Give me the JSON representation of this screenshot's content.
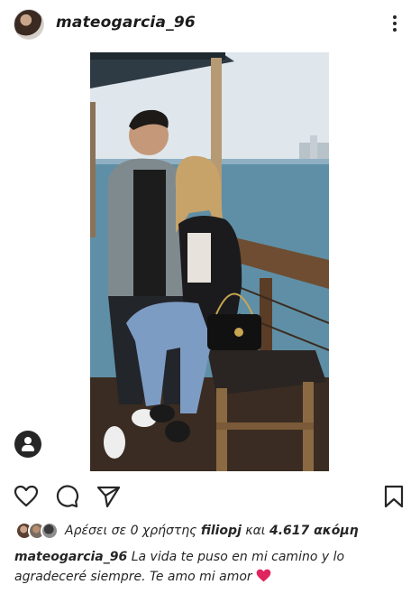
{
  "header": {
    "username": "mateogarcia_96",
    "avatar_icon": "user-avatar",
    "more_icon": "more-vertical-icon"
  },
  "post": {
    "tag_icon": "user-tag-icon"
  },
  "actions": {
    "like_icon": "heart-icon",
    "comment_icon": "comment-icon",
    "share_icon": "send-icon",
    "save_icon": "bookmark-icon"
  },
  "likes": {
    "prefix": "Αρέσει σε ",
    "middle": "0 χρήστης ",
    "user": "filiopj",
    "connector": " και ",
    "count": "4.617",
    "suffix": " ακόμη"
  },
  "caption": {
    "username": "mateogarcia_96",
    "text": " La vida te puso en mi camino y lo agradeceré siempre. Te amo mi amor ",
    "emoji": "red-heart-emoji"
  },
  "colors": {
    "text": "#262626",
    "heart_emoji": "#e0245e"
  }
}
